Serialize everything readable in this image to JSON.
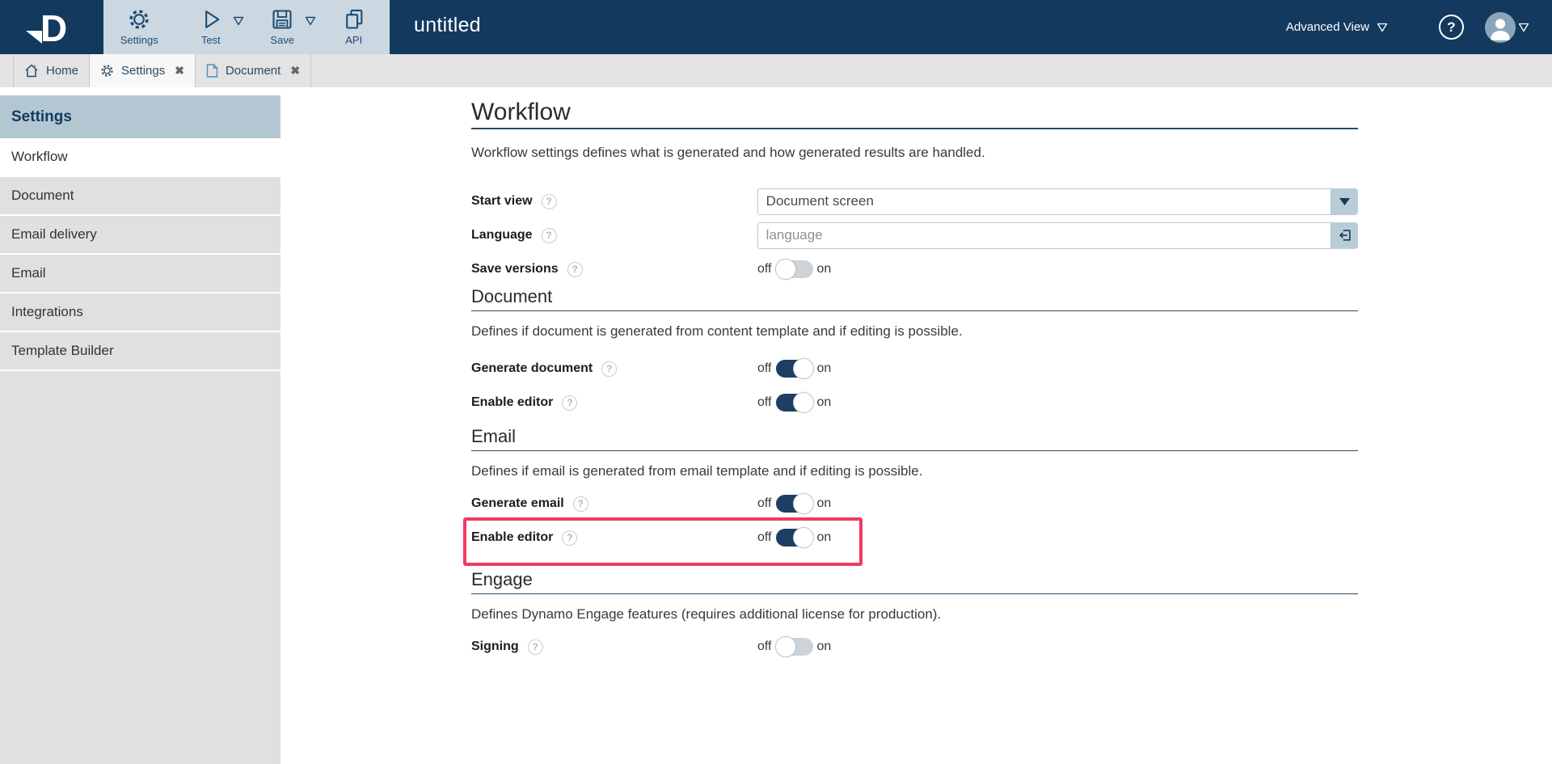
{
  "topbar": {
    "title": "untitled",
    "toolbar": [
      {
        "label": "Settings",
        "icon": "gear-icon",
        "has_dropdown": false
      },
      {
        "label": "Test",
        "icon": "play-icon",
        "has_dropdown": true
      },
      {
        "label": "Save",
        "icon": "save-icon",
        "has_dropdown": true
      },
      {
        "label": "API",
        "icon": "copy-icon",
        "has_dropdown": false
      }
    ],
    "advanced_view_label": "Advanced View",
    "help_glyph": "?"
  },
  "tabs": [
    {
      "label": "Home",
      "icon": "home-icon",
      "closable": false,
      "active": false
    },
    {
      "label": "Settings",
      "icon": "gear-icon",
      "closable": true,
      "active": true
    },
    {
      "label": "Document",
      "icon": "document-icon",
      "closable": true,
      "active": false
    }
  ],
  "close_glyph": "✖",
  "sidebar": {
    "header": "Settings",
    "items": [
      {
        "label": "Workflow",
        "selected": true
      },
      {
        "label": "Document",
        "selected": false
      },
      {
        "label": "Email delivery",
        "selected": false
      },
      {
        "label": "Email",
        "selected": false
      },
      {
        "label": "Integrations",
        "selected": false
      },
      {
        "label": "Template Builder",
        "selected": false
      }
    ]
  },
  "main": {
    "title": "Workflow",
    "description": "Workflow settings defines what is generated and how generated results are handled.",
    "toggle_off_label": "off",
    "toggle_on_label": "on",
    "fields": {
      "start_view": {
        "label": "Start view",
        "value": "Document screen"
      },
      "language": {
        "label": "Language",
        "placeholder": "language"
      },
      "save_versions": {
        "label": "Save versions",
        "state": "off"
      }
    },
    "sections": [
      {
        "title": "Document",
        "description": "Defines if document is generated from content template and if editing is possible.",
        "toggles": [
          {
            "label": "Generate document",
            "state": "on",
            "highlighted": false
          },
          {
            "label": "Enable editor",
            "state": "on",
            "highlighted": false
          }
        ]
      },
      {
        "title": "Email",
        "description": "Defines if email is generated from email template and if editing is possible.",
        "toggles": [
          {
            "label": "Generate email",
            "state": "on",
            "highlighted": false
          },
          {
            "label": "Enable editor",
            "state": "on",
            "highlighted": true
          }
        ]
      },
      {
        "title": "Engage",
        "description": "Defines Dynamo Engage features (requires additional license for production).",
        "toggles": [
          {
            "label": "Signing",
            "state": "off",
            "highlighted": false
          }
        ]
      }
    ]
  },
  "colors": {
    "topbar_navy": "#14395e",
    "toolbar_bg": "#ccd8e1",
    "sidebar_header_bg": "#b3c7d3",
    "sidebar_bg": "#e0e0e0",
    "toggle_on": "#1c3f63",
    "highlight_border": "#f23a61",
    "document_icon_blue": "#4a8fc0"
  }
}
